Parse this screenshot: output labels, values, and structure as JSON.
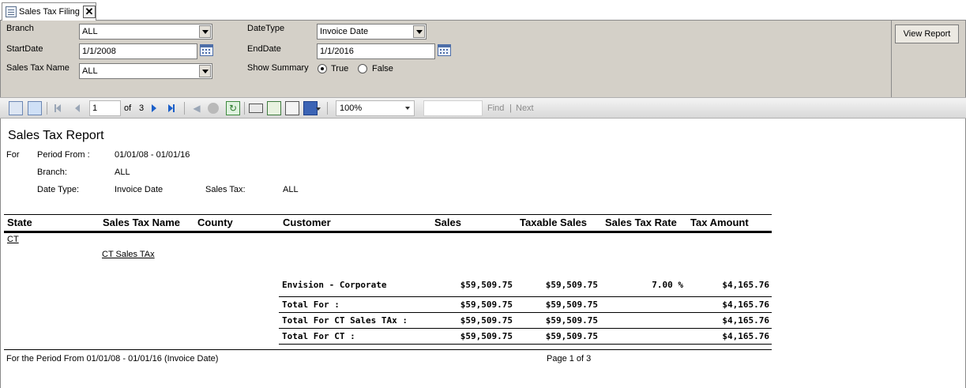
{
  "tab": {
    "label": "Sales Tax Filing",
    "close": "✕"
  },
  "params": {
    "branch": {
      "label": "Branch",
      "value": "ALL"
    },
    "start_date": {
      "label": "StartDate",
      "value": "1/1/2008"
    },
    "sales_tax_name": {
      "label": "Sales Tax Name",
      "value": "ALL"
    },
    "date_type": {
      "label": "DateType",
      "value": "Invoice Date"
    },
    "end_date": {
      "label": "EndDate",
      "value": "1/1/2016"
    },
    "show_summary": {
      "label": "Show Summary",
      "options": [
        "True",
        "False"
      ],
      "selected": "True"
    },
    "view_report": "View Report"
  },
  "toolbar": {
    "page": "1",
    "of_label": "of",
    "total_pages": "3",
    "zoom": "100%",
    "find_value": "",
    "find": "Find",
    "separator": "|",
    "next": "Next"
  },
  "report": {
    "title": "Sales Tax Report",
    "for_label": "For",
    "period_label": "Period From :",
    "period_value": "01/01/08 - 01/01/16",
    "branch_label": "Branch:",
    "branch_value": "ALL",
    "date_type_label": "Date Type:",
    "date_type_value": "Invoice Date",
    "sales_tax_label": "Sales Tax:",
    "sales_tax_value": "ALL",
    "columns": [
      "State",
      "Sales Tax Name",
      "County",
      "Customer",
      "Sales",
      "Taxable Sales",
      "Sales Tax Rate",
      "Tax Amount"
    ],
    "state": "CT",
    "tax_name": "CT Sales TAx",
    "detail": {
      "customer": "Envision - Corporate",
      "sales": "$59,509.75",
      "taxable": "$59,509.75",
      "rate": "7.00 %",
      "tax": "$4,165.76"
    },
    "totals": [
      {
        "label": "Total For  :",
        "sales": "$59,509.75",
        "taxable": "$59,509.75",
        "tax": "$4,165.76"
      },
      {
        "label": "Total For  CT Sales TAx :",
        "sales": "$59,509.75",
        "taxable": "$59,509.75",
        "tax": "$4,165.76"
      },
      {
        "label": "Total For  CT  :",
        "sales": "$59,509.75",
        "taxable": "$59,509.75",
        "tax": "$4,165.76"
      }
    ],
    "footer_left": "For the Period From 01/01/08 - 01/01/16 (Invoice Date)",
    "footer_page": "Page 1 of 3"
  }
}
